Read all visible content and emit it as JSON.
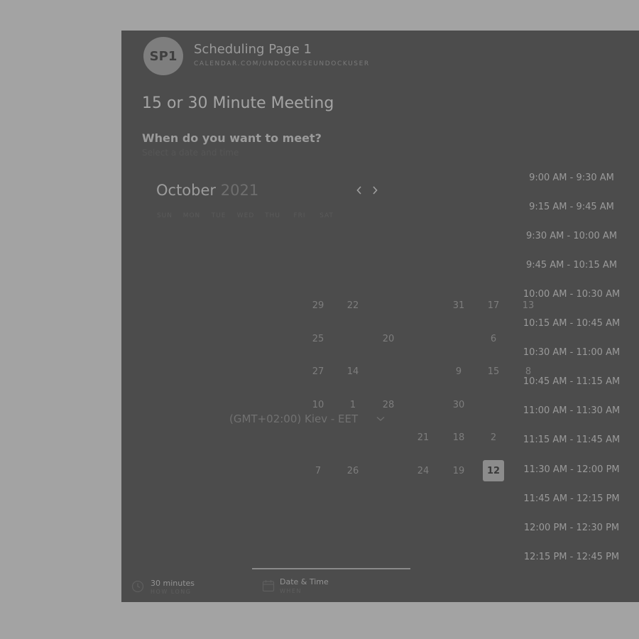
{
  "header": {
    "avatar_initials": "SP1",
    "page_name": "Scheduling Page 1",
    "page_url": "CALENDAR.COM/UNDOCKUSEUNDOCKUSER"
  },
  "meeting": {
    "title": "15 or 30 Minute Meeting",
    "question": "When do you want to meet?",
    "subtitle": "Select a date and time"
  },
  "calendar": {
    "month": "October",
    "year": "2021",
    "prev_icon": "chevron-left-icon",
    "next_icon": "chevron-right-icon",
    "weekdays": [
      "SUN",
      "MON",
      "TUE",
      "WED",
      "THU",
      "FRI",
      "SAT"
    ],
    "selected_day": "12",
    "days": [
      {
        "label": "29",
        "row": 0,
        "col": 0
      },
      {
        "label": "22",
        "row": 0,
        "col": 1
      },
      {
        "label": "31",
        "row": 0,
        "col": 4
      },
      {
        "label": "17",
        "row": 0,
        "col": 5
      },
      {
        "label": "13",
        "row": 0,
        "col": 6
      },
      {
        "label": "25",
        "row": 1,
        "col": 0
      },
      {
        "label": "20",
        "row": 1,
        "col": 2
      },
      {
        "label": "6",
        "row": 1,
        "col": 5
      },
      {
        "label": "27",
        "row": 2,
        "col": 0
      },
      {
        "label": "14",
        "row": 2,
        "col": 1
      },
      {
        "label": "9",
        "row": 2,
        "col": 4
      },
      {
        "label": "15",
        "row": 2,
        "col": 5
      },
      {
        "label": "8",
        "row": 2,
        "col": 6
      },
      {
        "label": "10",
        "row": 3,
        "col": 0
      },
      {
        "label": "1",
        "row": 3,
        "col": 1
      },
      {
        "label": "28",
        "row": 3,
        "col": 2
      },
      {
        "label": "30",
        "row": 3,
        "col": 4
      },
      {
        "label": "21",
        "row": 4,
        "col": 3
      },
      {
        "label": "18",
        "row": 4,
        "col": 4
      },
      {
        "label": "2",
        "row": 4,
        "col": 5
      },
      {
        "label": "7",
        "row": 5,
        "col": 0
      },
      {
        "label": "26",
        "row": 5,
        "col": 1
      },
      {
        "label": "24",
        "row": 5,
        "col": 3
      },
      {
        "label": "19",
        "row": 5,
        "col": 4
      },
      {
        "label": "12",
        "row": 5,
        "col": 5
      }
    ]
  },
  "timezone": {
    "label": "(GMT+02:00) Kiev - EET",
    "chevron_icon": "chevron-down-icon"
  },
  "time_slots": [
    "9:00 AM - 9:30 AM",
    "9:15 AM - 9:45 AM",
    "9:30 AM - 10:00 AM",
    "9:45 AM - 10:15 AM",
    "10:00 AM - 10:30 AM",
    "10:15 AM - 10:45 AM",
    "10:30 AM - 11:00 AM",
    "10:45 AM - 11:15 AM",
    "11:00 AM - 11:30 AM",
    "11:15 AM - 11:45 AM",
    "11:30 AM - 12:00 PM",
    "11:45 AM - 12:15 PM",
    "12:00 PM - 12:30 PM",
    "12:15 PM - 12:45 PM"
  ],
  "footer": {
    "duration_icon": "clock-icon",
    "duration_label": "30 minutes",
    "duration_sub": "HOW LONG",
    "date_icon": "calendar-icon",
    "date_label": "Date & Time",
    "date_sub": "WHEN"
  }
}
